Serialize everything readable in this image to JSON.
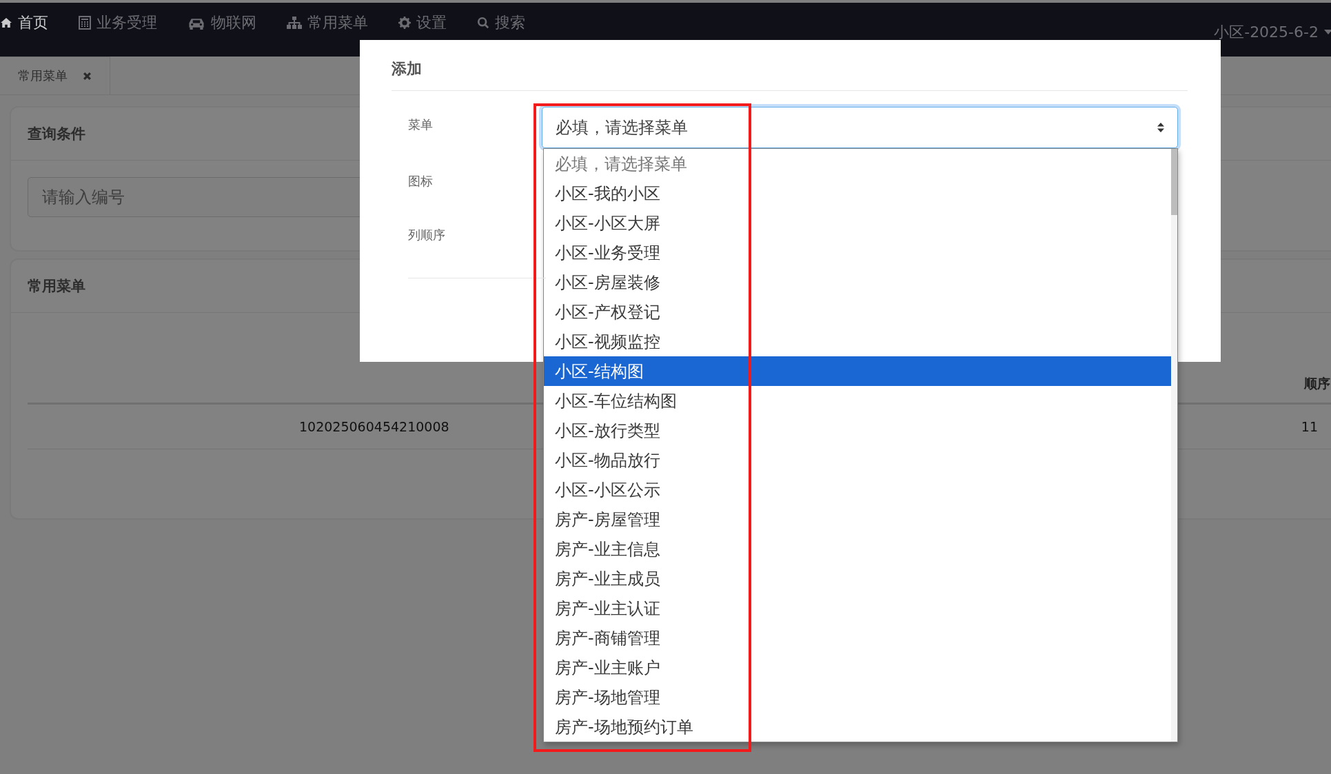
{
  "nav": {
    "items": [
      {
        "label": "首页",
        "selected": true
      },
      {
        "label": "业务受理",
        "selected": false
      },
      {
        "label": "物联网",
        "selected": false
      },
      {
        "label": "常用菜单",
        "selected": false
      },
      {
        "label": "设置",
        "selected": false
      },
      {
        "label": "搜索",
        "selected": false
      }
    ],
    "user": "小区-2025-6-2"
  },
  "tabs": [
    {
      "label": "常用菜单"
    }
  ],
  "query_panel": {
    "title": "查询条件",
    "search": {
      "placeholder": "请输入编号"
    }
  },
  "list_panel": {
    "title": "常用菜单",
    "table": {
      "header": [
        "顺序"
      ],
      "rows": [
        [
          "102025060454210008",
          "11"
        ]
      ]
    }
  },
  "modal": {
    "title": "添加",
    "fields": [
      {
        "label": "菜单"
      },
      {
        "label": "图标"
      },
      {
        "label": "列顺序"
      }
    ],
    "select": {
      "value": "必填，请选择菜单",
      "options": [
        {
          "label": "必填，请选择菜单",
          "highlighted": false,
          "disabled": true
        },
        {
          "label": "小区-我的小区",
          "highlighted": false,
          "disabled": false
        },
        {
          "label": "小区-小区大屏",
          "highlighted": false,
          "disabled": false
        },
        {
          "label": "小区-业务受理",
          "highlighted": false,
          "disabled": false
        },
        {
          "label": "小区-房屋装修",
          "highlighted": false,
          "disabled": false
        },
        {
          "label": "小区-产权登记",
          "highlighted": false,
          "disabled": false
        },
        {
          "label": "小区-视频监控",
          "highlighted": false,
          "disabled": false
        },
        {
          "label": "小区-结构图",
          "highlighted": true,
          "disabled": false
        },
        {
          "label": "小区-车位结构图",
          "highlighted": false,
          "disabled": false
        },
        {
          "label": "小区-放行类型",
          "highlighted": false,
          "disabled": false
        },
        {
          "label": "小区-物品放行",
          "highlighted": false,
          "disabled": false
        },
        {
          "label": "小区-小区公示",
          "highlighted": false,
          "disabled": false
        },
        {
          "label": "房产-房屋管理",
          "highlighted": false,
          "disabled": false
        },
        {
          "label": "房产-业主信息",
          "highlighted": false,
          "disabled": false
        },
        {
          "label": "房产-业主成员",
          "highlighted": false,
          "disabled": false
        },
        {
          "label": "房产-业主认证",
          "highlighted": false,
          "disabled": false
        },
        {
          "label": "房产-商铺管理",
          "highlighted": false,
          "disabled": false
        },
        {
          "label": "房产-业主账户",
          "highlighted": false,
          "disabled": false
        },
        {
          "label": "房产-场地管理",
          "highlighted": false,
          "disabled": false
        },
        {
          "label": "房产-场地预约订单",
          "highlighted": false,
          "disabled": false
        }
      ]
    }
  }
}
